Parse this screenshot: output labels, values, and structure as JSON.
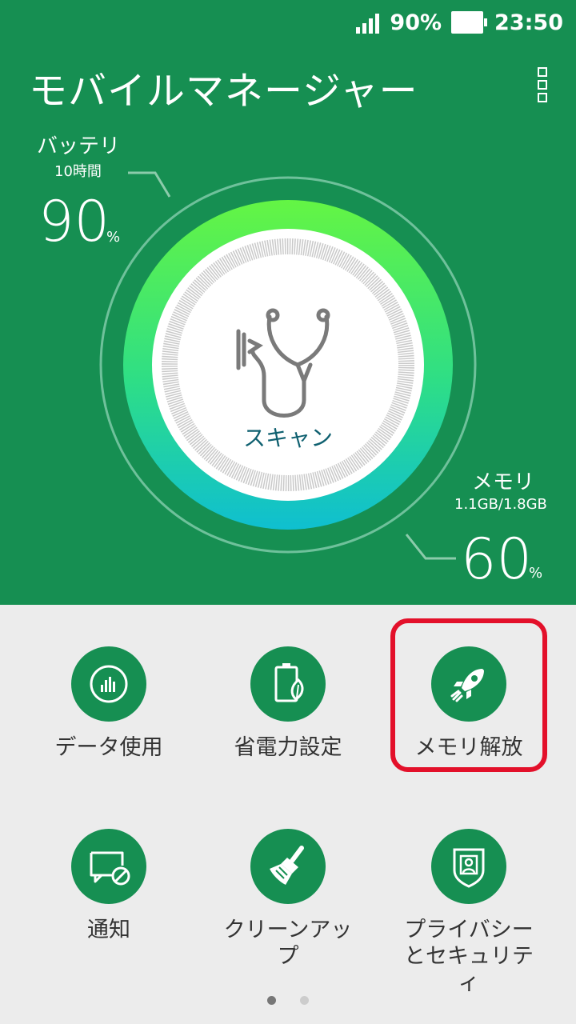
{
  "status_bar": {
    "battery_text": "90%",
    "time": "23:50"
  },
  "header": {
    "title": "モバイルマネージャー"
  },
  "battery": {
    "label": "バッテリ",
    "remaining": "10時間",
    "value": "90",
    "unit": "%"
  },
  "memory": {
    "label": "メモリ",
    "usage": "1.1GB/1.8GB",
    "value": "60",
    "unit": "%"
  },
  "scan": {
    "label": "スキャン"
  },
  "tiles": [
    {
      "label": "データ使用",
      "icon": "bar-chart-icon"
    },
    {
      "label": "省電力設定",
      "icon": "battery-leaf-icon"
    },
    {
      "label": "メモリ解放",
      "icon": "rocket-icon"
    },
    {
      "label": "通知",
      "icon": "notification-block-icon"
    },
    {
      "label": "クリーンアップ",
      "icon": "broom-icon"
    },
    {
      "label": "プライバシーとセキュリティ",
      "icon": "shield-user-icon"
    }
  ],
  "colors": {
    "header_bg": "#168f52",
    "accent": "#168f52",
    "highlight": "#e3102a",
    "scan_text": "#0f6070"
  },
  "pager": {
    "pages": 2,
    "current": 1
  }
}
